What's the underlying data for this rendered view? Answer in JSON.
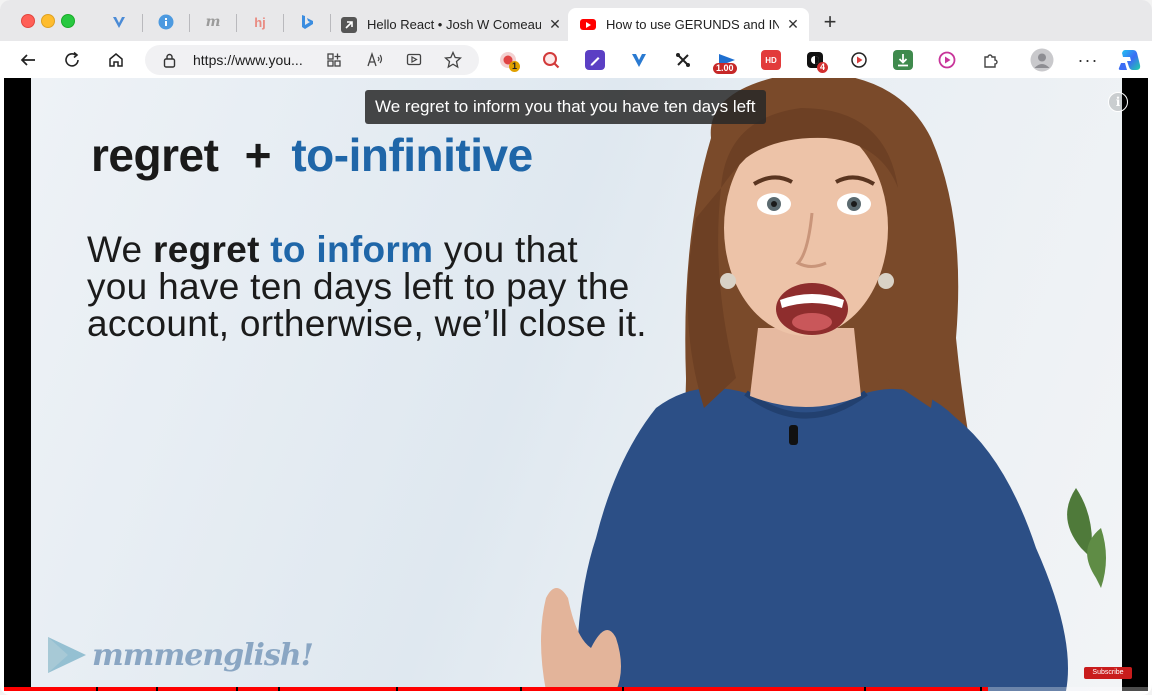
{
  "tabs": {
    "pinned": [
      {
        "icon": "vee-icon",
        "color": "#4b8bd6"
      },
      {
        "icon": "info-circle-icon",
        "color": "#4d9ae0"
      },
      {
        "icon": "m-letter-icon",
        "color": "#9b9b9b"
      },
      {
        "icon": "hj-icon",
        "color": "#e98b82"
      },
      {
        "icon": "bing-b-icon",
        "color": "#3b8de0"
      }
    ],
    "items": [
      {
        "title": "Hello React • Josh W Comeau",
        "active": false
      },
      {
        "title": "How to use GERUNDS and INFI",
        "active": true
      }
    ]
  },
  "toolbar": {
    "url": "https://www.you...",
    "extensions": [
      {
        "icon": "record-icon",
        "badge": "1",
        "color": "#e04343"
      },
      {
        "icon": "magnifier-icon",
        "badge": "",
        "color": "#d23a3a"
      },
      {
        "icon": "pen-icon",
        "badge": "",
        "color": "#5b3fc4"
      },
      {
        "icon": "vee-icon",
        "badge": "",
        "color": "#2a7ad1"
      },
      {
        "icon": "arrows-icon",
        "badge": "",
        "color": "#222222"
      },
      {
        "icon": "speed-icon",
        "badge": "1.00",
        "color": "#1e6fd0"
      },
      {
        "icon": "hd-icon",
        "badge": "",
        "color": "#e23b3b"
      },
      {
        "icon": "dark-mode-icon",
        "badge": "4",
        "color": "#111111"
      },
      {
        "icon": "video-icon",
        "badge": "",
        "color": "#d93d3d"
      },
      {
        "icon": "download-icon",
        "badge": "",
        "color": "#3f8a4d"
      },
      {
        "icon": "play-circle-icon",
        "badge": "",
        "color": "#c8359a"
      },
      {
        "icon": "puzzle-icon",
        "badge": "",
        "color": "#444444"
      }
    ]
  },
  "video": {
    "caption": "We regret to inform you that you have ten days left",
    "heading_word": "regret",
    "heading_plus": "+",
    "heading_rule": "to-infinitive",
    "sentence": {
      "part1": "We ",
      "bold": "regret",
      "space": " ",
      "blue": "to inform",
      "rest": " you that you have ten days left to pay the account, ortherwise, we’ll close it."
    },
    "logo_text": "mmmenglish!",
    "subscribe_label": "Subscribe",
    "progress": 0.86
  }
}
